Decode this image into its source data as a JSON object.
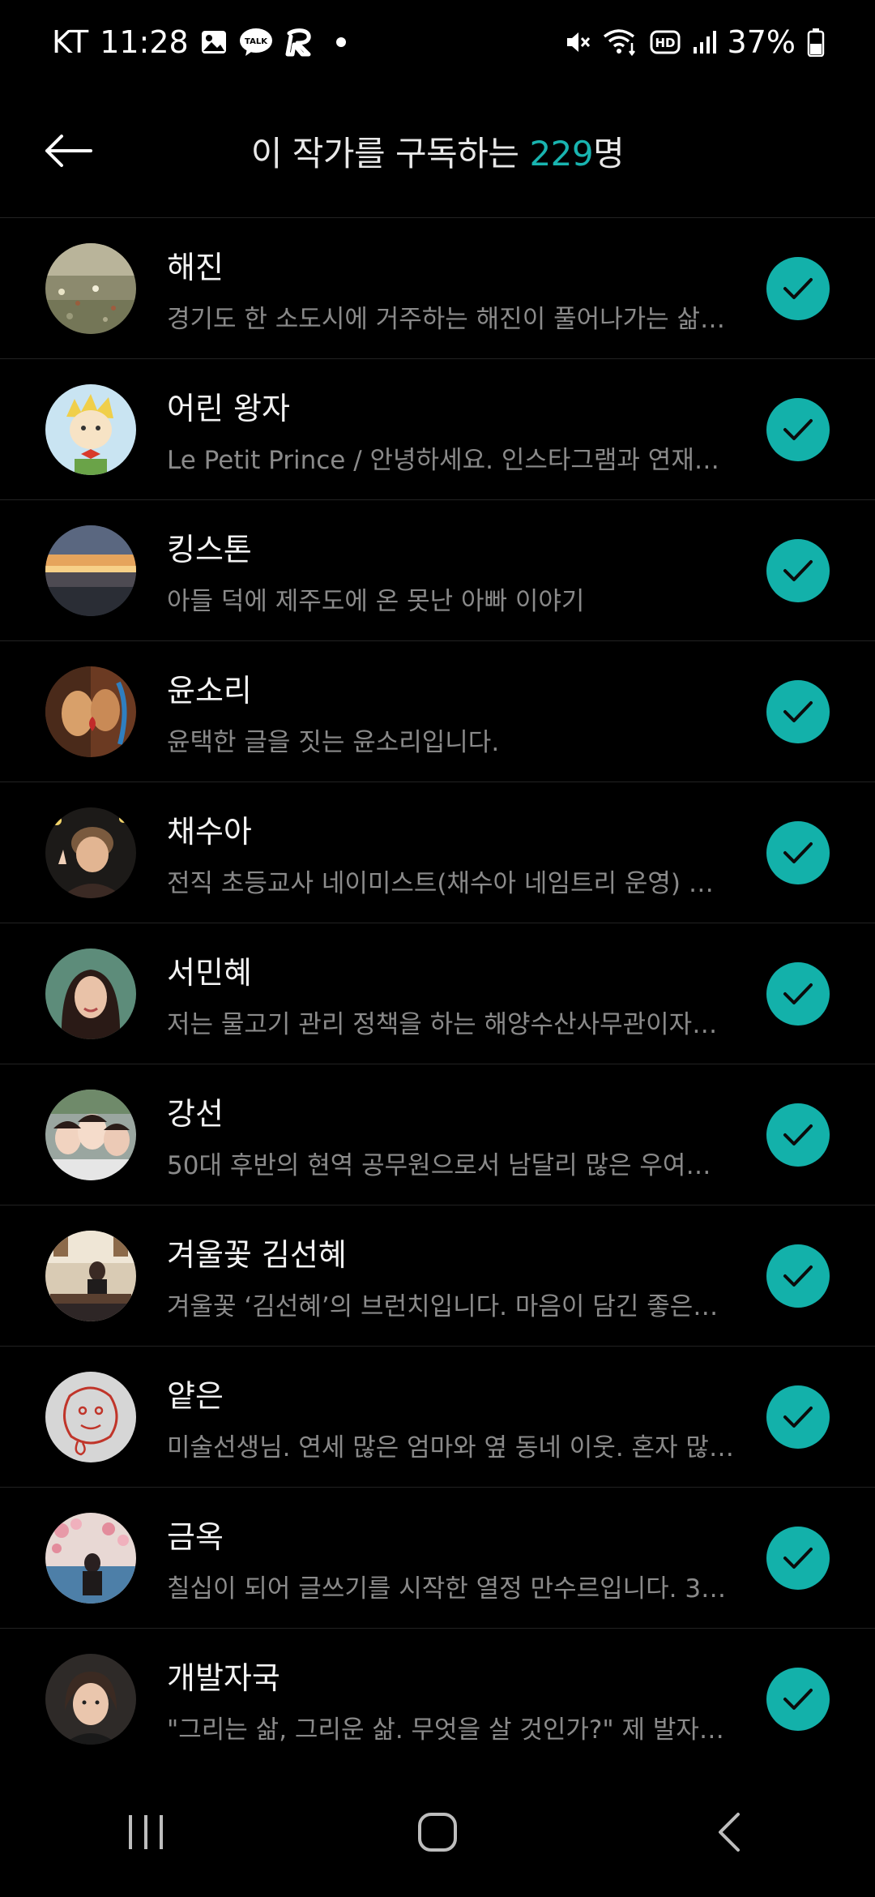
{
  "status": {
    "carrier": "KT",
    "time": "11:28",
    "battery": "37%",
    "icons_left": [
      "gallery-icon",
      "kakaotalk-icon",
      "app-r-icon",
      "notification-dot-icon"
    ],
    "icons_right": [
      "mute-icon",
      "wifi-icon",
      "hd-icon",
      "signal-icon",
      "battery-icon"
    ],
    "talk_label": "TALK",
    "hd_label": "HD"
  },
  "header": {
    "title_prefix": "이 작가를 구독하는 ",
    "count": "229",
    "title_suffix": "명"
  },
  "accent": "#13b1aa",
  "subscribers": [
    {
      "name": "해진",
      "desc": "경기도 한 소도시에 거주하는 해진이 풀어나가는 삶…"
    },
    {
      "name": "어린 왕자",
      "desc": "Le Petit Prince / 안녕하세요. 인스타그램과 연재…"
    },
    {
      "name": "킹스톤",
      "desc": "아들 덕에 제주도에 온 못난 아빠 이야기"
    },
    {
      "name": "윤소리",
      "desc": "윤택한 글을 짓는 윤소리입니다."
    },
    {
      "name": "채수아",
      "desc": "전직 초등교사 네이미스트(채수아 네임트리 운영) …"
    },
    {
      "name": "서민혜",
      "desc": "저는 물고기 관리 정책을 하는 해양수산사무관이자…"
    },
    {
      "name": "강선",
      "desc": "50대 후반의 현역 공무원으로서 남달리 많은 우여…"
    },
    {
      "name": "겨울꽃 김선혜",
      "desc": "겨울꽃 ‘김선혜’의 브런치입니다. 마음이  담긴 좋은…"
    },
    {
      "name": "얕은",
      "desc": "미술선생님. 연세 많은 엄마와 옆 동네 이웃. 혼자 많…"
    },
    {
      "name": "금옥",
      "desc": "칠십이 되어 글쓰기를 시작한 열정 만수르입니다. 3…"
    },
    {
      "name": "개발자국",
      "desc": "\"그리는 삶, 그리운 삶. 무엇을 살 것인가?\" 제 발자…"
    }
  ]
}
